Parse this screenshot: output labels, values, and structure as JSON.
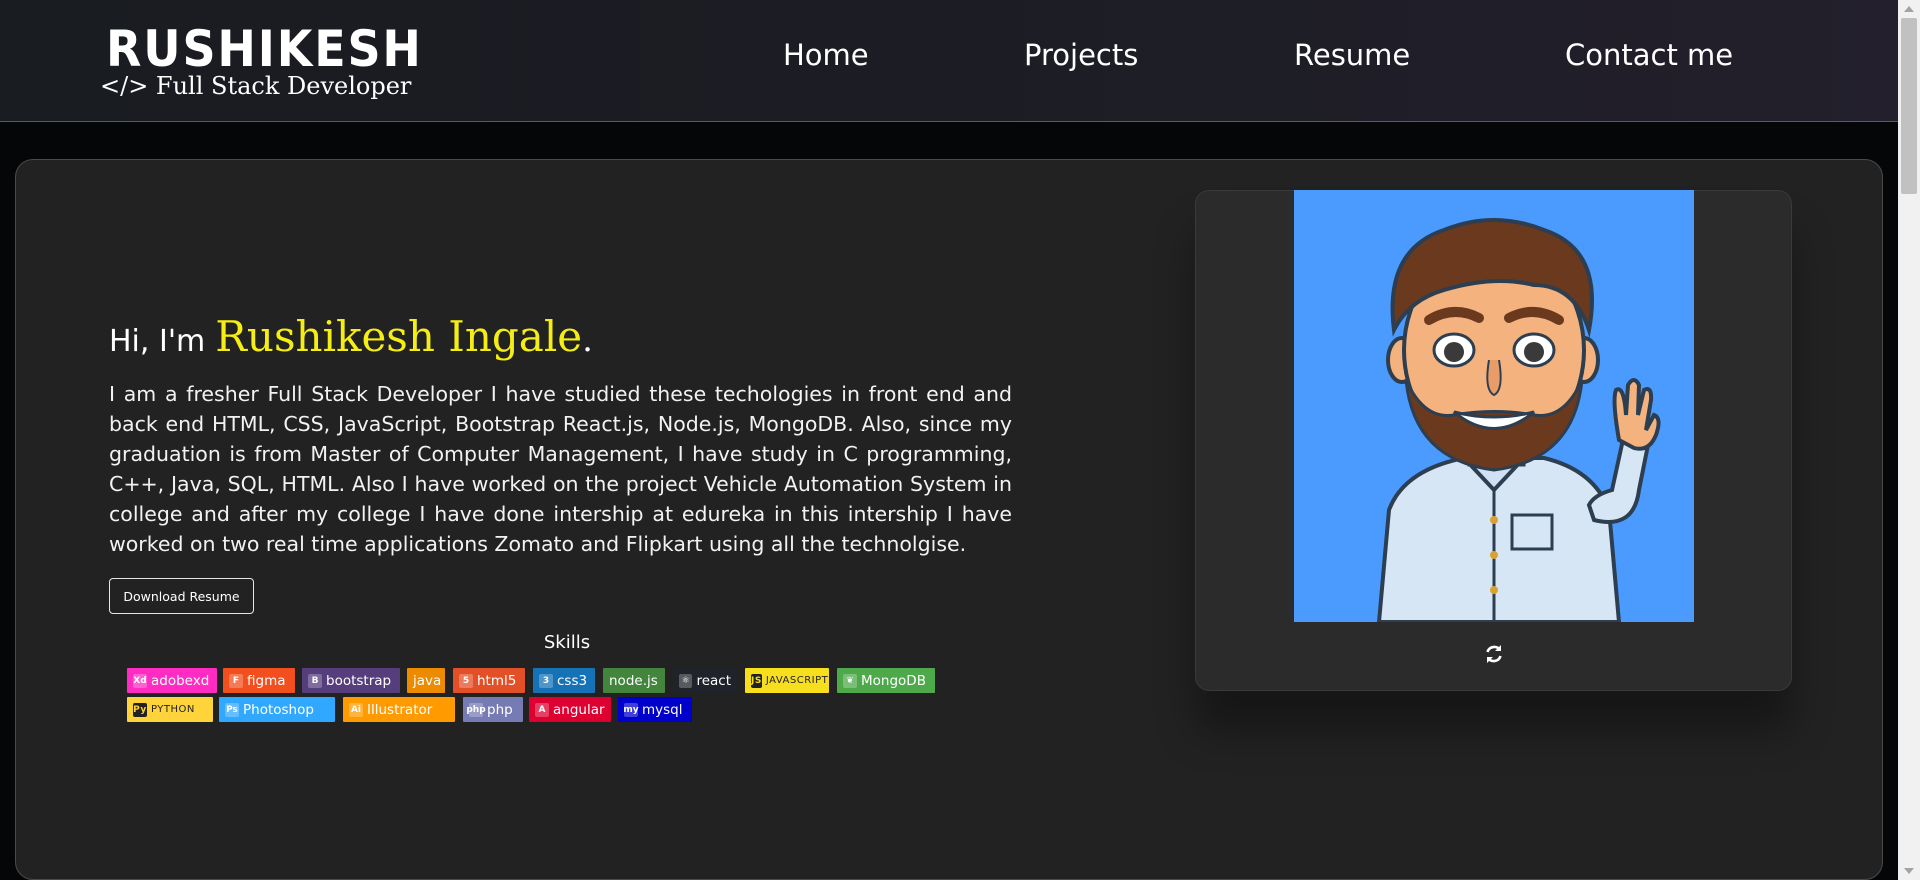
{
  "header": {
    "logo_name": "RUSHIKESH",
    "logo_subtitle": "</> Full Stack Developer",
    "nav": [
      {
        "label": "Home"
      },
      {
        "label": "Projects"
      },
      {
        "label": "Resume"
      },
      {
        "label": "Contact me"
      }
    ]
  },
  "hero": {
    "greeting": "Hi, I'm",
    "name": "Rushikesh Ingale",
    "name_suffix": ".",
    "bio": "I am a fresher Full Stack Developer I have studied these techologies in front end and back end HTML, CSS, JavaScript, Bootstrap React.js, Node.js, MongoDB. Also, since my graduation is from Master of Computer Management, I have study in C programming, C++, Java, SQL, HTML. Also I have worked on the project Vehicle Automation System in college and after my college I have done intership at edureka in this intership I have worked on two real time applications Zomato and Flipkart using all the technolgise.",
    "download_button": "Download Resume",
    "skills_title": "Skills",
    "skills": [
      {
        "label": "adobexd",
        "icon": "Xd",
        "color": "#ff2bc2"
      },
      {
        "label": "figma",
        "icon": "F",
        "color": "#f24e1e"
      },
      {
        "label": "bootstrap",
        "icon": "B",
        "color": "#563d7c"
      },
      {
        "label": "java",
        "icon": "",
        "color": "#ed8b00"
      },
      {
        "label": "html5",
        "icon": "5",
        "color": "#e34f26"
      },
      {
        "label": "css3",
        "icon": "3",
        "color": "#1572b6"
      },
      {
        "label": "node.js",
        "icon": "",
        "color": "#43853d"
      },
      {
        "label": "react",
        "icon": "⚛",
        "color": "#20232a"
      },
      {
        "label": "JAVASCRIPT",
        "icon": "JS",
        "color": "#f7df1e"
      },
      {
        "label": "MongoDB",
        "icon": "❦",
        "color": "#4ea94b"
      },
      {
        "label": "PYTHON",
        "icon": "Py",
        "color": "#ffd43b"
      },
      {
        "label": "Photoshop",
        "icon": "Ps",
        "color": "#31a8ff"
      },
      {
        "label": "Illustrator",
        "icon": "Ai",
        "color": "#ff9a00"
      },
      {
        "label": "php",
        "icon": "php",
        "color": "#777bb4"
      },
      {
        "label": "angular",
        "icon": "A",
        "color": "#dd0031"
      },
      {
        "label": "mysql",
        "icon": "my",
        "color": "#0000cc"
      }
    ],
    "avatar_bg": "#4b9bff",
    "accent": "#f5ee14"
  },
  "icons": {
    "refresh": "refresh-icon"
  }
}
